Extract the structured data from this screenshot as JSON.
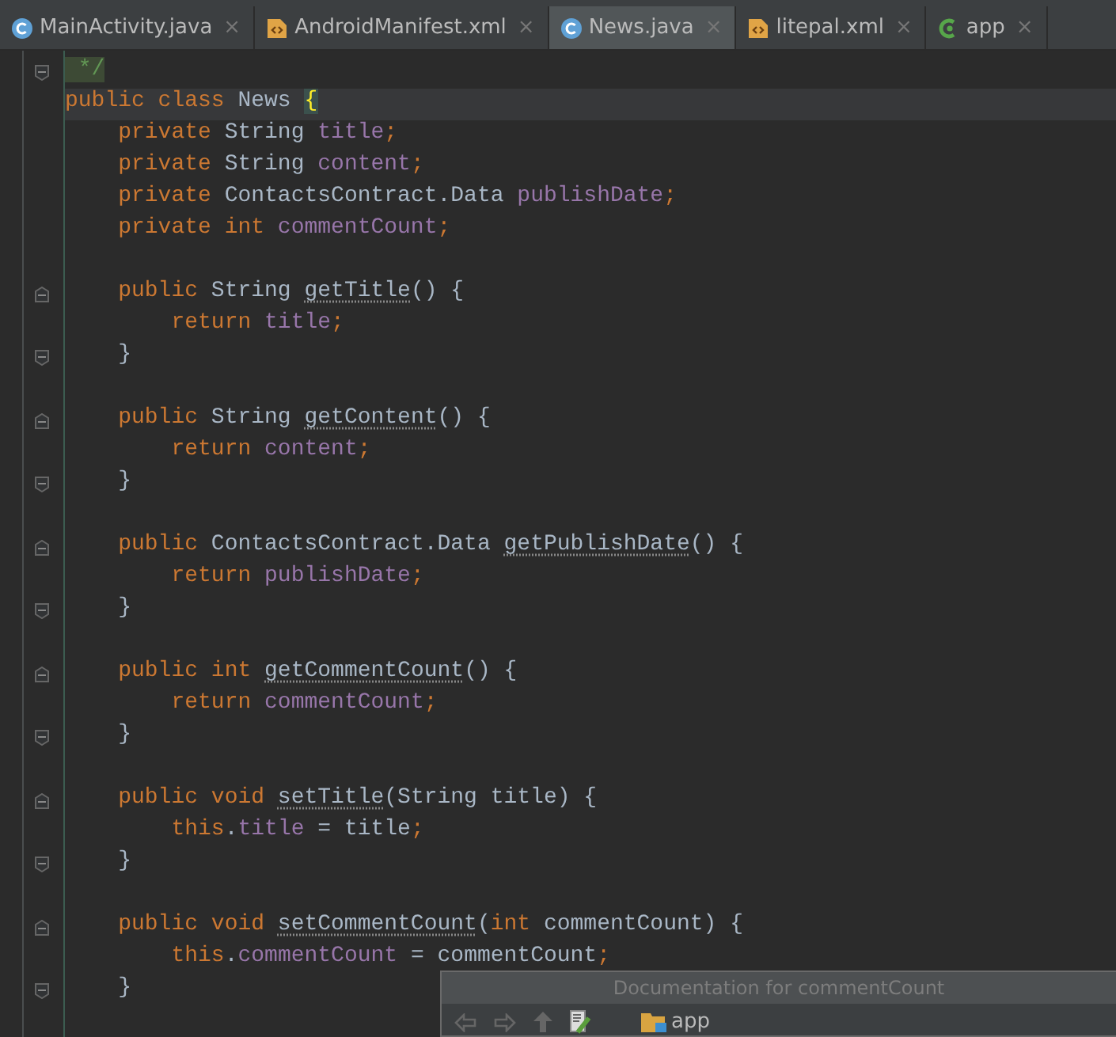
{
  "tabs": [
    {
      "label": "MainActivity.java",
      "kind": "class",
      "selected": false
    },
    {
      "label": "AndroidManifest.xml",
      "kind": "xml",
      "selected": false
    },
    {
      "label": "News.java",
      "kind": "class",
      "selected": true
    },
    {
      "label": "litepal.xml",
      "kind": "xml",
      "selected": false
    },
    {
      "label": "app",
      "kind": "module",
      "selected": false
    }
  ],
  "close_label": "×",
  "code_lines": [
    {
      "current": false,
      "kind": "closer",
      "tokens": [
        {
          "kind": "comment",
          "text": " */"
        }
      ]
    },
    {
      "current": true,
      "kind": "code",
      "tokens": [
        {
          "kind": "keyword",
          "text": "public class "
        },
        {
          "kind": "plain",
          "text": "News "
        },
        {
          "kind": "brace",
          "text": "{"
        }
      ]
    },
    {
      "current": false,
      "kind": "code",
      "tokens": [
        {
          "kind": "keyword",
          "text": "    private "
        },
        {
          "kind": "plain",
          "text": "String "
        },
        {
          "kind": "field",
          "text": "title"
        },
        {
          "kind": "keyword",
          "text": ";"
        }
      ]
    },
    {
      "current": false,
      "kind": "code",
      "tokens": [
        {
          "kind": "keyword",
          "text": "    private "
        },
        {
          "kind": "plain",
          "text": "String "
        },
        {
          "kind": "field",
          "text": "content"
        },
        {
          "kind": "keyword",
          "text": ";"
        }
      ]
    },
    {
      "current": false,
      "kind": "code",
      "tokens": [
        {
          "kind": "keyword",
          "text": "    private "
        },
        {
          "kind": "plain",
          "text": "ContactsContract.Data "
        },
        {
          "kind": "field",
          "text": "publishDate"
        },
        {
          "kind": "keyword",
          "text": ";"
        }
      ]
    },
    {
      "current": false,
      "kind": "code",
      "tokens": [
        {
          "kind": "keyword",
          "text": "    private int "
        },
        {
          "kind": "field",
          "text": "commentCount"
        },
        {
          "kind": "keyword",
          "text": ";"
        }
      ]
    },
    {
      "current": false,
      "kind": "blank"
    },
    {
      "current": false,
      "kind": "opener",
      "tokens": [
        {
          "kind": "keyword",
          "text": "    public "
        },
        {
          "kind": "plain",
          "text": "String "
        },
        {
          "kind": "method",
          "text": "getTitle"
        },
        {
          "kind": "plain",
          "text": "() {"
        }
      ]
    },
    {
      "current": false,
      "kind": "code",
      "tokens": [
        {
          "kind": "keyword",
          "text": "        return "
        },
        {
          "kind": "field",
          "text": "title"
        },
        {
          "kind": "keyword",
          "text": ";"
        }
      ]
    },
    {
      "current": false,
      "kind": "closer",
      "tokens": [
        {
          "kind": "plain",
          "text": "    }"
        }
      ]
    },
    {
      "current": false,
      "kind": "blank"
    },
    {
      "current": false,
      "kind": "opener",
      "tokens": [
        {
          "kind": "keyword",
          "text": "    public "
        },
        {
          "kind": "plain",
          "text": "String "
        },
        {
          "kind": "method",
          "text": "getContent"
        },
        {
          "kind": "plain",
          "text": "() {"
        }
      ]
    },
    {
      "current": false,
      "kind": "code",
      "tokens": [
        {
          "kind": "keyword",
          "text": "        return "
        },
        {
          "kind": "field",
          "text": "content"
        },
        {
          "kind": "keyword",
          "text": ";"
        }
      ]
    },
    {
      "current": false,
      "kind": "closer",
      "tokens": [
        {
          "kind": "plain",
          "text": "    }"
        }
      ]
    },
    {
      "current": false,
      "kind": "blank"
    },
    {
      "current": false,
      "kind": "opener",
      "tokens": [
        {
          "kind": "keyword",
          "text": "    public "
        },
        {
          "kind": "plain",
          "text": "ContactsContract.Data "
        },
        {
          "kind": "method",
          "text": "getPublishDate"
        },
        {
          "kind": "plain",
          "text": "() {"
        }
      ]
    },
    {
      "current": false,
      "kind": "code",
      "tokens": [
        {
          "kind": "keyword",
          "text": "        return "
        },
        {
          "kind": "field",
          "text": "publishDate"
        },
        {
          "kind": "keyword",
          "text": ";"
        }
      ]
    },
    {
      "current": false,
      "kind": "closer",
      "tokens": [
        {
          "kind": "plain",
          "text": "    }"
        }
      ]
    },
    {
      "current": false,
      "kind": "blank"
    },
    {
      "current": false,
      "kind": "opener",
      "tokens": [
        {
          "kind": "keyword",
          "text": "    public int "
        },
        {
          "kind": "method",
          "text": "getCommentCount"
        },
        {
          "kind": "plain",
          "text": "() {"
        }
      ]
    },
    {
      "current": false,
      "kind": "code",
      "tokens": [
        {
          "kind": "keyword",
          "text": "        return "
        },
        {
          "kind": "field",
          "text": "commentCount"
        },
        {
          "kind": "keyword",
          "text": ";"
        }
      ]
    },
    {
      "current": false,
      "kind": "closer",
      "tokens": [
        {
          "kind": "plain",
          "text": "    }"
        }
      ]
    },
    {
      "current": false,
      "kind": "blank"
    },
    {
      "current": false,
      "kind": "opener",
      "tokens": [
        {
          "kind": "keyword",
          "text": "    public void "
        },
        {
          "kind": "method",
          "text": "setTitle"
        },
        {
          "kind": "plain",
          "text": "(String title) {"
        }
      ]
    },
    {
      "current": false,
      "kind": "code",
      "tokens": [
        {
          "kind": "keyword",
          "text": "        this"
        },
        {
          "kind": "plain",
          "text": "."
        },
        {
          "kind": "field",
          "text": "title"
        },
        {
          "kind": "plain",
          "text": " = title"
        },
        {
          "kind": "keyword",
          "text": ";"
        }
      ]
    },
    {
      "current": false,
      "kind": "closer",
      "tokens": [
        {
          "kind": "plain",
          "text": "    }"
        }
      ]
    },
    {
      "current": false,
      "kind": "blank"
    },
    {
      "current": false,
      "kind": "opener",
      "tokens": [
        {
          "kind": "keyword",
          "text": "    public void "
        },
        {
          "kind": "method",
          "text": "setCommentCount"
        },
        {
          "kind": "plain",
          "text": "("
        },
        {
          "kind": "keyword",
          "text": "int "
        },
        {
          "kind": "plain",
          "text": "commentCount) {"
        }
      ]
    },
    {
      "current": false,
      "kind": "code",
      "tokens": [
        {
          "kind": "keyword",
          "text": "        this"
        },
        {
          "kind": "plain",
          "text": "."
        },
        {
          "kind": "field",
          "text": "commentCount"
        },
        {
          "kind": "plain",
          "text": " = commentCount"
        },
        {
          "kind": "keyword",
          "text": ";"
        }
      ]
    },
    {
      "current": false,
      "kind": "closer",
      "tokens": [
        {
          "kind": "plain",
          "text": "    }"
        }
      ]
    }
  ],
  "doc_popup": {
    "title": "Documentation for commentCount",
    "location": "app"
  }
}
